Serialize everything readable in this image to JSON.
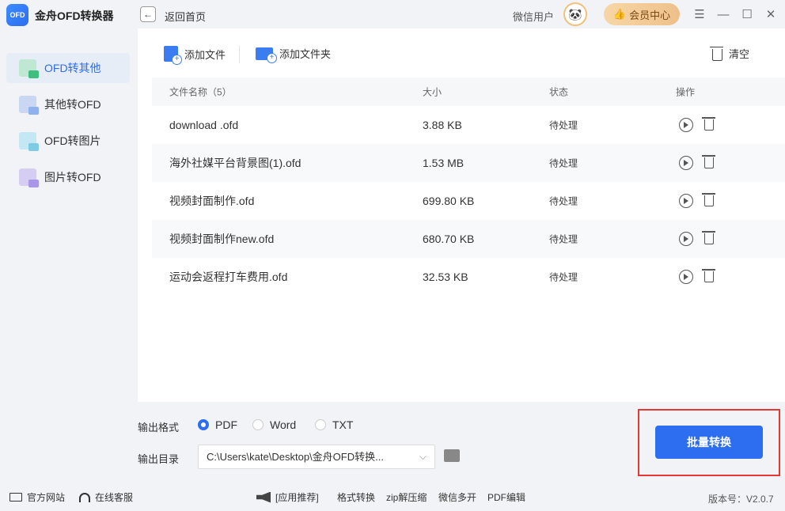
{
  "app": {
    "title": "金舟OFD转换器",
    "logo_text": "OFD"
  },
  "header": {
    "back_label": "返回首页",
    "user_name": "微信用户",
    "vip_label": "会员中心"
  },
  "window_controls": {
    "menu": "☰",
    "minimize": "—",
    "maximize": "☐",
    "close": "✕"
  },
  "sidebar": {
    "items": [
      {
        "label": "OFD转其他",
        "active": true
      },
      {
        "label": "其他转OFD",
        "active": false
      },
      {
        "label": "OFD转图片",
        "active": false
      },
      {
        "label": "图片转OFD",
        "active": false
      }
    ]
  },
  "toolbar": {
    "add_file": "添加文件",
    "add_folder": "添加文件夹",
    "clear": "清空"
  },
  "table": {
    "headers": {
      "name": "文件名称（5）",
      "size": "大小",
      "status": "状态",
      "action": "操作"
    },
    "rows": [
      {
        "name": "download .ofd",
        "size": "3.88 KB",
        "status": "待处理"
      },
      {
        "name": "海外社媒平台背景图(1).ofd",
        "size": "1.53 MB",
        "status": "待处理"
      },
      {
        "name": "视频封面制作.ofd",
        "size": "699.80 KB",
        "status": "待处理"
      },
      {
        "name": "视频封面制作new.ofd",
        "size": "680.70 KB",
        "status": "待处理"
      },
      {
        "name": "运动会返程打车费用.ofd",
        "size": "32.53 KB",
        "status": "待处理"
      }
    ]
  },
  "output": {
    "format_label": "输出格式",
    "formats": [
      {
        "label": "PDF",
        "selected": true
      },
      {
        "label": "Word",
        "selected": false
      },
      {
        "label": "TXT",
        "selected": false
      }
    ],
    "dir_label": "输出目录",
    "dir_value": "C:\\Users\\kate\\Desktop\\金舟OFD转换..."
  },
  "convert_button": "批量转换",
  "footer": {
    "website": "官方网站",
    "support": "在线客服",
    "recommend": "[应用推荐]",
    "links": [
      "格式转换",
      "zip解压缩",
      "微信多开",
      "PDF编辑"
    ],
    "version": "版本号：V2.0.7"
  },
  "colors": {
    "accent": "#2d6df0",
    "highlight": "#e53935",
    "vip": "#eec08a"
  }
}
